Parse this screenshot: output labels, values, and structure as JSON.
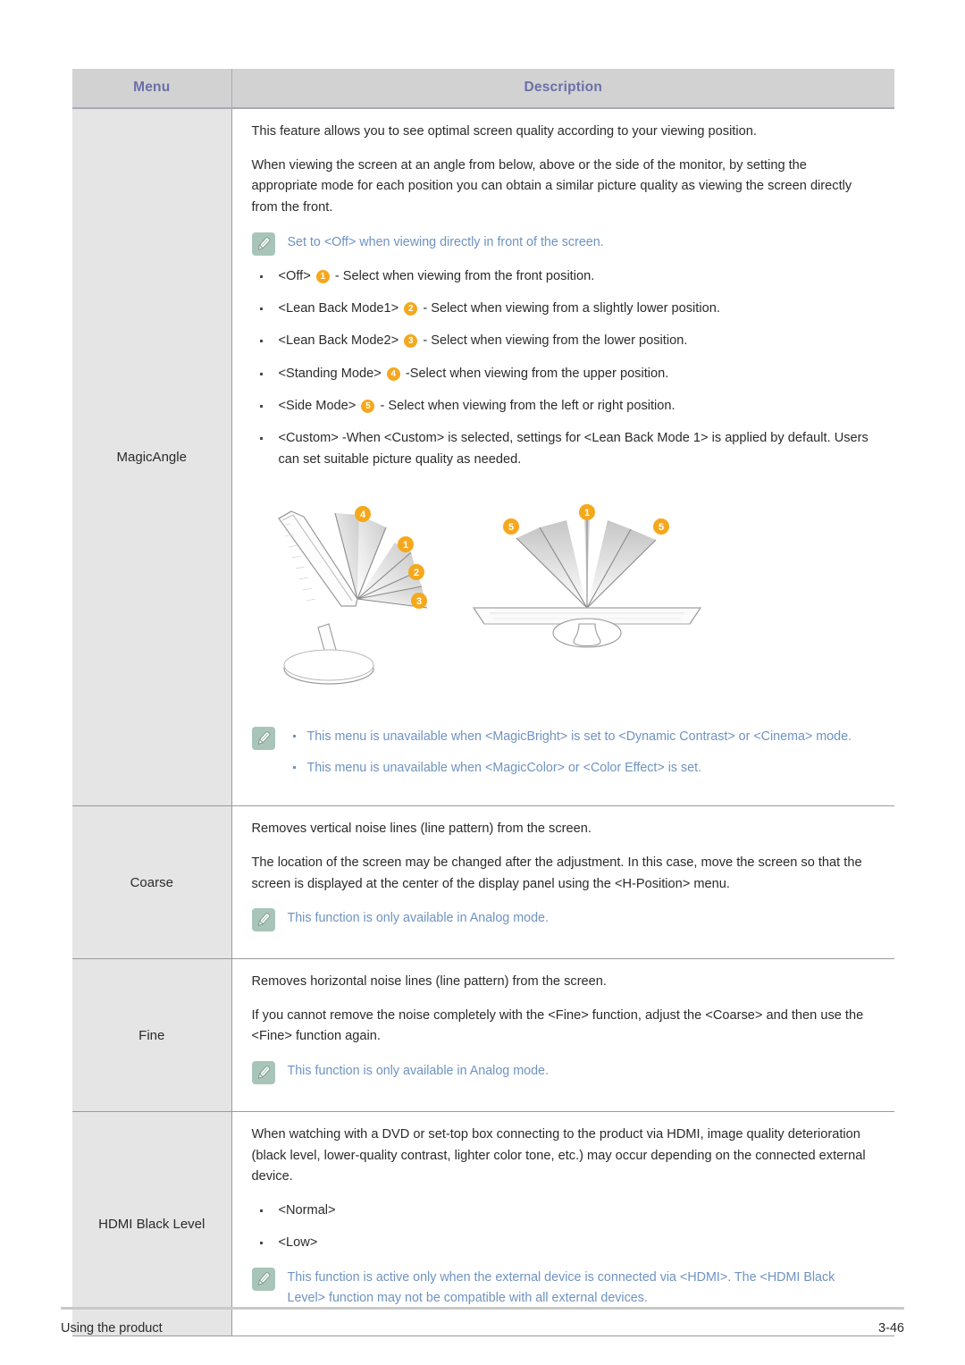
{
  "table": {
    "headers": {
      "menu": "Menu",
      "description": "Description"
    },
    "rows": [
      {
        "menu": "MagicAngle",
        "paragraphs": [
          "This feature allows you to see optimal screen quality according to your viewing position.",
          "When viewing the screen at an angle from below, above or the side of the monitor, by setting the appropriate mode for each position you can obtain a similar picture quality as viewing the screen directly from the front."
        ],
        "note_top": {
          "icon": "note-pencil-icon",
          "text": "Set to <Off> when viewing directly in front of the screen."
        },
        "options": [
          {
            "label": "<Off>",
            "badge": "1",
            "desc": "- Select when viewing from the front position."
          },
          {
            "label": "<Lean Back Mode1>",
            "badge": "2",
            "desc": "- Select when viewing from a slightly lower position."
          },
          {
            "label": "<Lean Back Mode2>",
            "badge": "3",
            "desc": "- Select when viewing from the lower position."
          },
          {
            "label": "<Standing Mode>",
            "badge": "4",
            "desc": "-Select when viewing from the upper position."
          },
          {
            "label": "<Side Mode>",
            "badge": "5",
            "desc": "- Select when viewing from the left or right position."
          },
          {
            "label": "<Custom>",
            "badge": "",
            "desc": "-When <Custom> is selected, settings for <Lean Back Mode 1> is applied by default. Users can set suitable picture quality as needed."
          }
        ],
        "diagram": {
          "name": "magicangle-viewing-angle-diagram",
          "side_view_badges": [
            "4",
            "1",
            "2",
            "3"
          ],
          "top_view_badges": [
            "5",
            "1",
            "5"
          ]
        },
        "note_bottom": {
          "icon": "note-pencil-icon",
          "bullets": [
            "This menu is unavailable when <MagicBright> is set to <Dynamic Contrast> or <Cinema> mode.",
            "This menu is unavailable when <MagicColor> or <Color Effect> is set."
          ]
        }
      },
      {
        "menu": "Coarse",
        "paragraphs": [
          "Removes vertical noise lines (line pattern) from the screen.",
          "The location of the screen may be changed after the adjustment. In this case, move the screen so that the screen is displayed at the center of the display panel using the <H-Position> menu."
        ],
        "note": {
          "icon": "note-pencil-icon",
          "text": "This function is only available in Analog mode."
        }
      },
      {
        "menu": "Fine",
        "paragraphs": [
          "Removes horizontal noise lines (line pattern) from the screen.",
          "If you cannot remove the noise completely with the <Fine> function, adjust the <Coarse> and then use the <Fine> function again."
        ],
        "note": {
          "icon": "note-pencil-icon",
          "text": "This function is only available in Analog mode."
        }
      },
      {
        "menu": "HDMI Black Level",
        "paragraphs": [
          "When watching with a DVD or set-top box connecting to the product via HDMI, image quality deterioration (black level, lower-quality contrast, lighter color tone, etc.) may occur depending on the connected external device."
        ],
        "options": [
          {
            "label": "<Normal>",
            "badge": "",
            "desc": ""
          },
          {
            "label": "<Low>",
            "badge": "",
            "desc": ""
          }
        ],
        "note": {
          "icon": "note-pencil-icon",
          "text": "This function is active only when the external device is connected via <HDMI>. The <HDMI Black Level> function may not be compatible with all external devices."
        }
      }
    ]
  },
  "footer": {
    "left": "Using the product",
    "right": "3-46"
  },
  "colors": {
    "header_bg": "#d2d2d2",
    "header_text": "#6b6fa8",
    "menu_col_bg": "#e5e5e5",
    "note_icon_bg": "#a9c4b8",
    "note_text": "#6e93c2",
    "badge_bg": "#f5a81c",
    "body_text": "#2b2b2b"
  }
}
